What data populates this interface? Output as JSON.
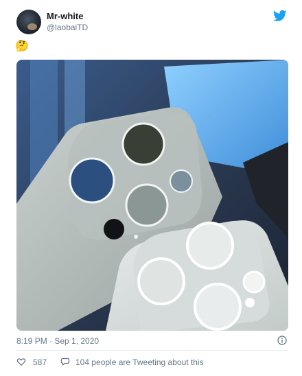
{
  "tweet": {
    "author": {
      "display_name": "Mr-white",
      "handle": "@laobaiTD"
    },
    "text_emoji": "🤔",
    "media": {
      "description_icon": "photo-icon"
    },
    "timestamp": "8:19 PM · Sep 1, 2020",
    "likes": "587",
    "replies_text": "104 people are Tweeting about this"
  },
  "icons": {
    "brand": "twitter-bird-icon",
    "info": "info-icon",
    "like": "heart-icon",
    "reply": "speech-bubble-icon"
  },
  "colors": {
    "brand": "#1da1f2",
    "secondary_text": "#657786",
    "primary_text": "#14171a"
  }
}
